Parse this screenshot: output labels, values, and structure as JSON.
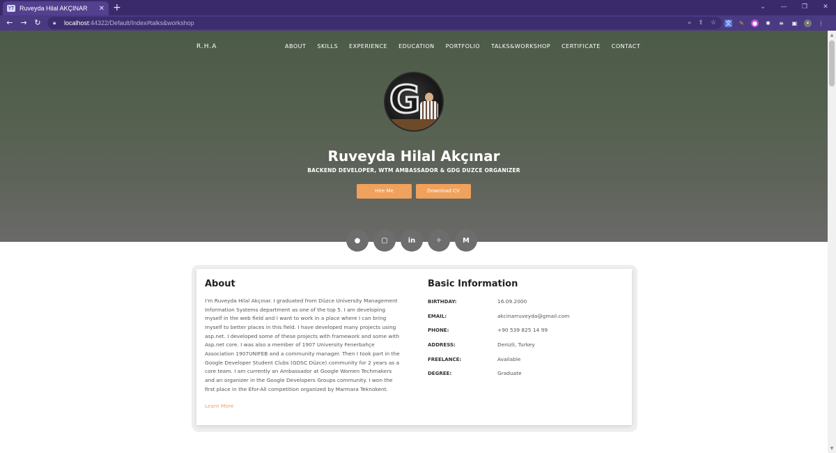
{
  "browser": {
    "tab_title": "Ruveyda Hilal AKÇINAR",
    "tab_favicon": "YT",
    "url_host": "localhost",
    "url_rest": ":44322/Default/Index#talks&workshop"
  },
  "site": {
    "brand": "R.H.A",
    "nav": [
      "ABOUT",
      "SKILLS",
      "EXPERIENCE",
      "EDUCATION",
      "PORTFOLIO",
      "TALKS&WORKSHOP",
      "CERTIFICATE",
      "CONTACT"
    ],
    "name": "Ruveyda Hilal Akçınar",
    "subtitle": "BACKEND DEVELOPER, WTM AMBASSADOR & GDG DUZCE ORGANIZER",
    "hire_label": "Hire Me",
    "cv_label": "Download CV",
    "socials": [
      {
        "icon": "github-icon",
        "glyph": "●"
      },
      {
        "icon": "instagram-icon",
        "glyph": "▢"
      },
      {
        "icon": "linkedin-icon",
        "glyph": "in"
      },
      {
        "icon": "twitter-icon",
        "glyph": "✧"
      },
      {
        "icon": "medium-icon",
        "glyph": "M"
      }
    ]
  },
  "about": {
    "title": "About",
    "text": "I'm Ruveyda Hilal Akçınar. I graduated from Düzce University Management Information Systems department as one of the top 5. I am developing myself in the web field and I want to work in a place where I can bring myself to better places in this field. I have developed many projects using asp.net. I developed some of these projects with framework and some with Asp.net core. I was also a member of 1907 University Fenerbahçe Association 1907UNIFEB and a community manager. Then I took part in the Google Developer Student Clubs (GDSC Düzce) community for 2 years as a core team. I am currently an Ambassador at Google Women Techmakers and an organizer in the Google Developers Groups community. I won the first place in the Efor-All competition organized by Marmara Teknokent.",
    "learn_more": "Learn More"
  },
  "basic": {
    "title": "Basic Information",
    "rows": [
      {
        "label": "BIRTHDAY:",
        "value": "16.09.2000"
      },
      {
        "label": "EMAIL:",
        "value": "akcinarruveyda@gmail.com"
      },
      {
        "label": "PHONE:",
        "value": "+90 539 825 14 99"
      },
      {
        "label": "ADDRESS:",
        "value": "Denizli, Turkey"
      },
      {
        "label": "FREELANCE:",
        "value": "Available"
      },
      {
        "label": "DEGREE:",
        "value": "Graduate"
      }
    ]
  }
}
